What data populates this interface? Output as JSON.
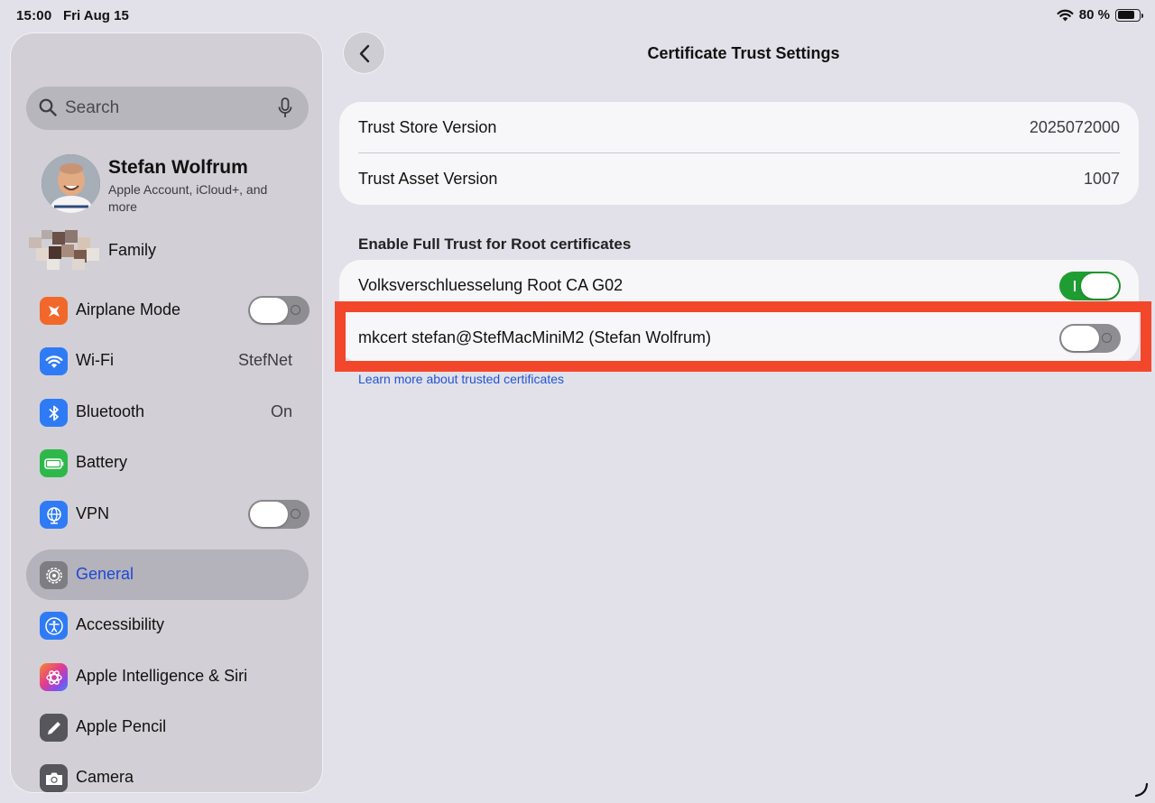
{
  "status_bar": {
    "time": "15:00",
    "date": "Fri Aug 15",
    "battery_percent": "80 %",
    "battery_level": 0.8,
    "icons": [
      "wifi-icon",
      "battery-icon"
    ]
  },
  "sidebar": {
    "search": {
      "placeholder": "Search"
    },
    "profile": {
      "name": "Stefan Wolfrum",
      "subtitle": "Apple Account, iCloud+, and more"
    },
    "family": {
      "label": "Family"
    },
    "items": [
      {
        "label": "Airplane Mode",
        "icon": "airplane-icon",
        "icon_color": "#f2682a",
        "toggle": false
      },
      {
        "label": "Wi-Fi",
        "icon": "wifi-icon",
        "icon_color": "#2f7bf5",
        "value": "StefNet"
      },
      {
        "label": "Bluetooth",
        "icon": "bluetooth-icon",
        "icon_color": "#2f7bf5",
        "value": "On"
      },
      {
        "label": "Battery",
        "icon": "battery-icon",
        "icon_color": "#2fb84a"
      },
      {
        "label": "VPN",
        "icon": "globe-icon",
        "icon_color": "#2f7bf5",
        "toggle": false
      },
      {
        "label": "General",
        "icon": "gear-icon",
        "icon_color": "#7d7d83",
        "selected": true
      },
      {
        "label": "Accessibility",
        "icon": "accessibility-icon",
        "icon_color": "#2f7bf5"
      },
      {
        "label": "Apple Intelligence & Siri",
        "icon": "siri-icon",
        "icon_color": "#c44fd9"
      },
      {
        "label": "Apple Pencil",
        "icon": "pencil-icon",
        "icon_color": "#56565c"
      },
      {
        "label": "Camera",
        "icon": "camera-icon",
        "icon_color": "#56565c"
      }
    ],
    "selected_color": "#1d49d6"
  },
  "main": {
    "title": "Certificate Trust Settings",
    "versions": [
      {
        "label": "Trust Store Version",
        "value": "2025072000"
      },
      {
        "label": "Trust Asset Version",
        "value": "1007"
      }
    ],
    "section_header": "Enable Full Trust for Root certificates",
    "certificates": [
      {
        "label": "Volksverschluesselung Root CA G02",
        "enabled": true
      },
      {
        "label": "mkcert stefan@StefMacMiniM2 (Stefan Wolfrum)",
        "enabled": false
      }
    ],
    "learn_more": "Learn more about trusted certificates",
    "highlight_color": "#f2472b",
    "toggle_on_color": "#1f9d32"
  }
}
